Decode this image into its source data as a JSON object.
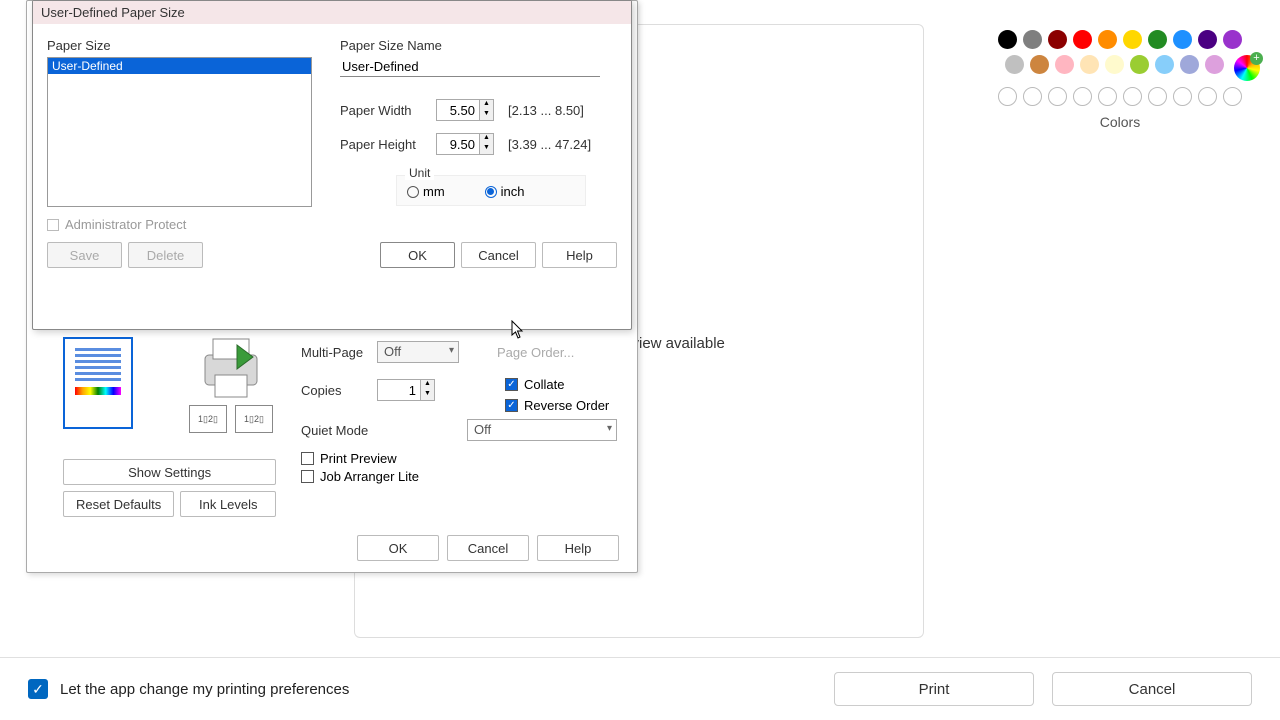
{
  "palette": {
    "label": "Colors",
    "row1": [
      "#000000",
      "#7f7f7f",
      "#8b0000",
      "#ff0000",
      "#ff8c00",
      "#ffd700",
      "#228b22",
      "#1e90ff",
      "#4b0082",
      "#9932cc"
    ],
    "row2": [
      "#ffffff",
      "#c0c0c0",
      "#cd853f",
      "#ffb6c1",
      "#ffe4b5",
      "#fffacd",
      "#9acd32",
      "#87cefa",
      "#9fa8da",
      "#dda0dd"
    ]
  },
  "preview_text": "No print preview available",
  "paper": {
    "title": "User-Defined Paper Size",
    "size_label": "Paper Size",
    "name_label": "Paper Size Name",
    "list_item": "User-Defined",
    "name_value": "User-Defined",
    "width_label": "Paper Width",
    "width_value": "5.50",
    "width_range": "[2.13 ... 8.50]",
    "height_label": "Paper Height",
    "height_value": "9.50",
    "height_range": "[3.39 ... 47.24]",
    "unit_label": "Unit",
    "unit_mm": "mm",
    "unit_inch": "inch",
    "admin_protect": "Administrator Protect",
    "save": "Save",
    "delete": "Delete",
    "ok": "OK",
    "cancel": "Cancel",
    "help": "Help"
  },
  "print": {
    "multipage_label": "Multi-Page",
    "multipage_value": "Off",
    "page_order": "Page Order...",
    "copies_label": "Copies",
    "copies_value": "1",
    "collate": "Collate",
    "reverse": "Reverse Order",
    "quiet_label": "Quiet Mode",
    "quiet_value": "Off",
    "print_preview": "Print Preview",
    "job_arranger": "Job Arranger Lite",
    "show_settings": "Show Settings",
    "reset_defaults": "Reset Defaults",
    "ink_levels": "Ink Levels",
    "ok": "OK",
    "cancel": "Cancel",
    "help": "Help"
  },
  "bottom": {
    "pref_label": "Let the app change my printing preferences",
    "print": "Print",
    "cancel": "Cancel"
  }
}
